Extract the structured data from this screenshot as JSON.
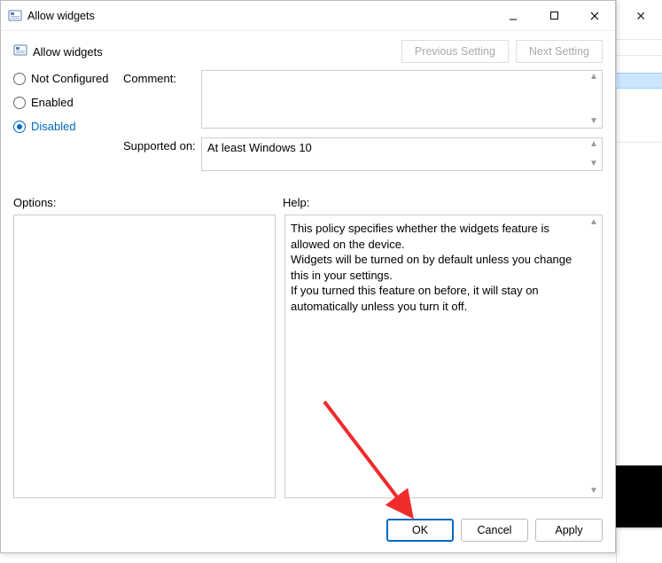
{
  "titlebar": {
    "title": "Allow widgets"
  },
  "subheader": {
    "title": "Allow widgets",
    "prev": "Previous Setting",
    "next": "Next Setting"
  },
  "radios": {
    "not_configured": "Not Configured",
    "enabled": "Enabled",
    "disabled": "Disabled"
  },
  "labels": {
    "comment": "Comment:",
    "supported_on": "Supported on:",
    "options": "Options:",
    "help": "Help:"
  },
  "fields": {
    "comment": "",
    "supported_on": "At least Windows 10"
  },
  "help_text": "This policy specifies whether the widgets feature is allowed on the device.\nWidgets will be turned on by default unless you change this in your settings.\nIf you turned this feature on before, it will stay on automatically unless you turn it off.",
  "buttons": {
    "ok": "OK",
    "cancel": "Cancel",
    "apply": "Apply"
  }
}
